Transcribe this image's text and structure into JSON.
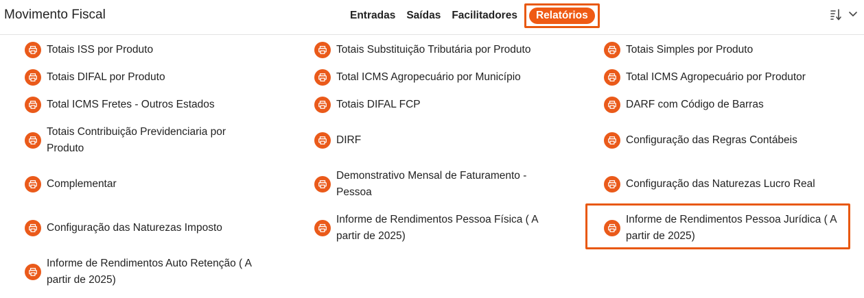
{
  "header": {
    "title": "Movimento Fiscal",
    "tabs": [
      {
        "label": "Entradas"
      },
      {
        "label": "Saídas"
      },
      {
        "label": "Facilitadores"
      },
      {
        "label": "Relatórios"
      }
    ],
    "sort_icon": "sort-icon",
    "dropdown_icon": "chevron-down-icon"
  },
  "colors": {
    "accent": "#ef5a14",
    "highlight_border": "#e8580f"
  },
  "reports": [
    {
      "label": "Totais ISS por Produto",
      "icon": "printer-icon"
    },
    {
      "label": "Totais Substituição Tributária por Produto",
      "icon": "printer-icon"
    },
    {
      "label": "Totais Simples por Produto",
      "icon": "printer-icon"
    },
    {
      "label": "Totais DIFAL por Produto",
      "icon": "printer-icon"
    },
    {
      "label": "Total ICMS Agropecuário por Município",
      "icon": "printer-icon"
    },
    {
      "label": "Total ICMS Agropecuário por Produtor",
      "icon": "printer-icon"
    },
    {
      "label": "Total ICMS Fretes - Outros Estados",
      "icon": "printer-icon"
    },
    {
      "label": "Totais DIFAL FCP",
      "icon": "printer-icon"
    },
    {
      "label": "DARF com Código de Barras",
      "icon": "printer-icon"
    },
    {
      "label": "Totais Contribuição Previdenciaria por Produto",
      "icon": "printer-icon"
    },
    {
      "label": "DIRF",
      "icon": "printer-icon"
    },
    {
      "label": "Configuração das Regras Contábeis",
      "icon": "printer-icon"
    },
    {
      "label": "Complementar",
      "icon": "printer-icon"
    },
    {
      "label": "Demonstrativo Mensal de Faturamento - Pessoa",
      "icon": "printer-icon"
    },
    {
      "label": "Configuração das Naturezas Lucro Real",
      "icon": "printer-icon"
    },
    {
      "label": "Configuração das Naturezas Imposto",
      "icon": "printer-icon"
    },
    {
      "label": "Informe de Rendimentos Pessoa Física ( A partir de 2025)",
      "icon": "printer-icon"
    },
    {
      "label": "Informe de Rendimentos Pessoa Jurídica ( A partir de 2025)",
      "icon": "printer-icon"
    },
    {
      "label": "Informe de Rendimentos Auto Retenção ( A partir de 2025)",
      "icon": "printer-icon"
    }
  ]
}
